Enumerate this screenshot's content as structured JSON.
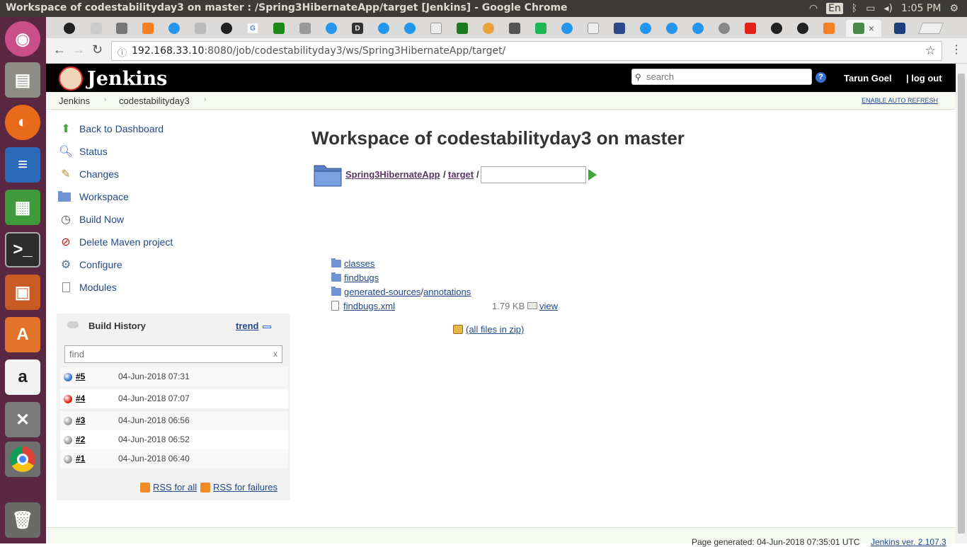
{
  "os": {
    "window_title": "Workspace of codestabilityday3 on master : /Spring3HibernateApp/target [Jenkins] - Google Chrome",
    "keyboard_layout": "En",
    "clock": "1:05 PM"
  },
  "browser": {
    "url_host": "192.168.33.10",
    "url_rest": ":8080/job/codestabilityday3/ws/Spring3HibernateApp/target/",
    "tab_close": "×"
  },
  "jenkins": {
    "logo_text": "Jenkins",
    "search_placeholder": "search",
    "help": "?",
    "user": "Tarun Goel",
    "logout": "| log out",
    "breadcrumb": [
      "Jenkins",
      "codestabilityday3"
    ],
    "breadcrumb_sep": "›",
    "auto_refresh": "ENABLE AUTO REFRESH"
  },
  "sidebar": {
    "tasks": [
      {
        "label": "Back to Dashboard",
        "icon": "up-arrow-icon"
      },
      {
        "label": "Status",
        "icon": "magnifier-icon"
      },
      {
        "label": "Changes",
        "icon": "notepad-icon"
      },
      {
        "label": "Workspace",
        "icon": "folder-icon"
      },
      {
        "label": "Build Now",
        "icon": "clock-icon"
      },
      {
        "label": "Delete Maven project",
        "icon": "no-entry-icon"
      },
      {
        "label": "Configure",
        "icon": "gear-icon"
      },
      {
        "label": "Modules",
        "icon": "document-icon"
      }
    ]
  },
  "build_history": {
    "title": "Build History",
    "trend": "trend",
    "find_placeholder": "find",
    "clear": "x",
    "builds": [
      {
        "number": "#5",
        "date": "04-Jun-2018 07:31",
        "status_color": "#3d6fcf"
      },
      {
        "number": "#4",
        "date": "04-Jun-2018 07:07",
        "status_color": "#e02020"
      },
      {
        "number": "#3",
        "date": "04-Jun-2018 06:56",
        "status_color": "#9a9a9a"
      },
      {
        "number": "#2",
        "date": "04-Jun-2018 06:52",
        "status_color": "#9a9a9a"
      },
      {
        "number": "#1",
        "date": "04-Jun-2018 06:40",
        "status_color": "#9a9a9a"
      }
    ],
    "rss_all": "RSS for all",
    "rss_failures": "RSS for failures"
  },
  "workspace": {
    "heading": "Workspace of codestabilityday3 on master",
    "path": [
      "Spring3HibernateApp",
      "target"
    ],
    "path_sep": "/",
    "entries": {
      "classes": "classes",
      "findbugs": "findbugs",
      "gen_sources": "generated-sources",
      "gen_sep": "/",
      "annotations": "annotations",
      "findbugs_xml": "findbugs.xml",
      "findbugs_xml_size": "1.79 KB",
      "view": "view"
    },
    "zip_link": "(all files in zip)"
  },
  "footer": {
    "generated": "Page generated: 04-Jun-2018 07:35:01 UTC",
    "version": "Jenkins ver. 2.107.3"
  },
  "colors": {
    "jenkins_header": "#000000",
    "link": "#204a87",
    "launcher": "#5b2843"
  }
}
